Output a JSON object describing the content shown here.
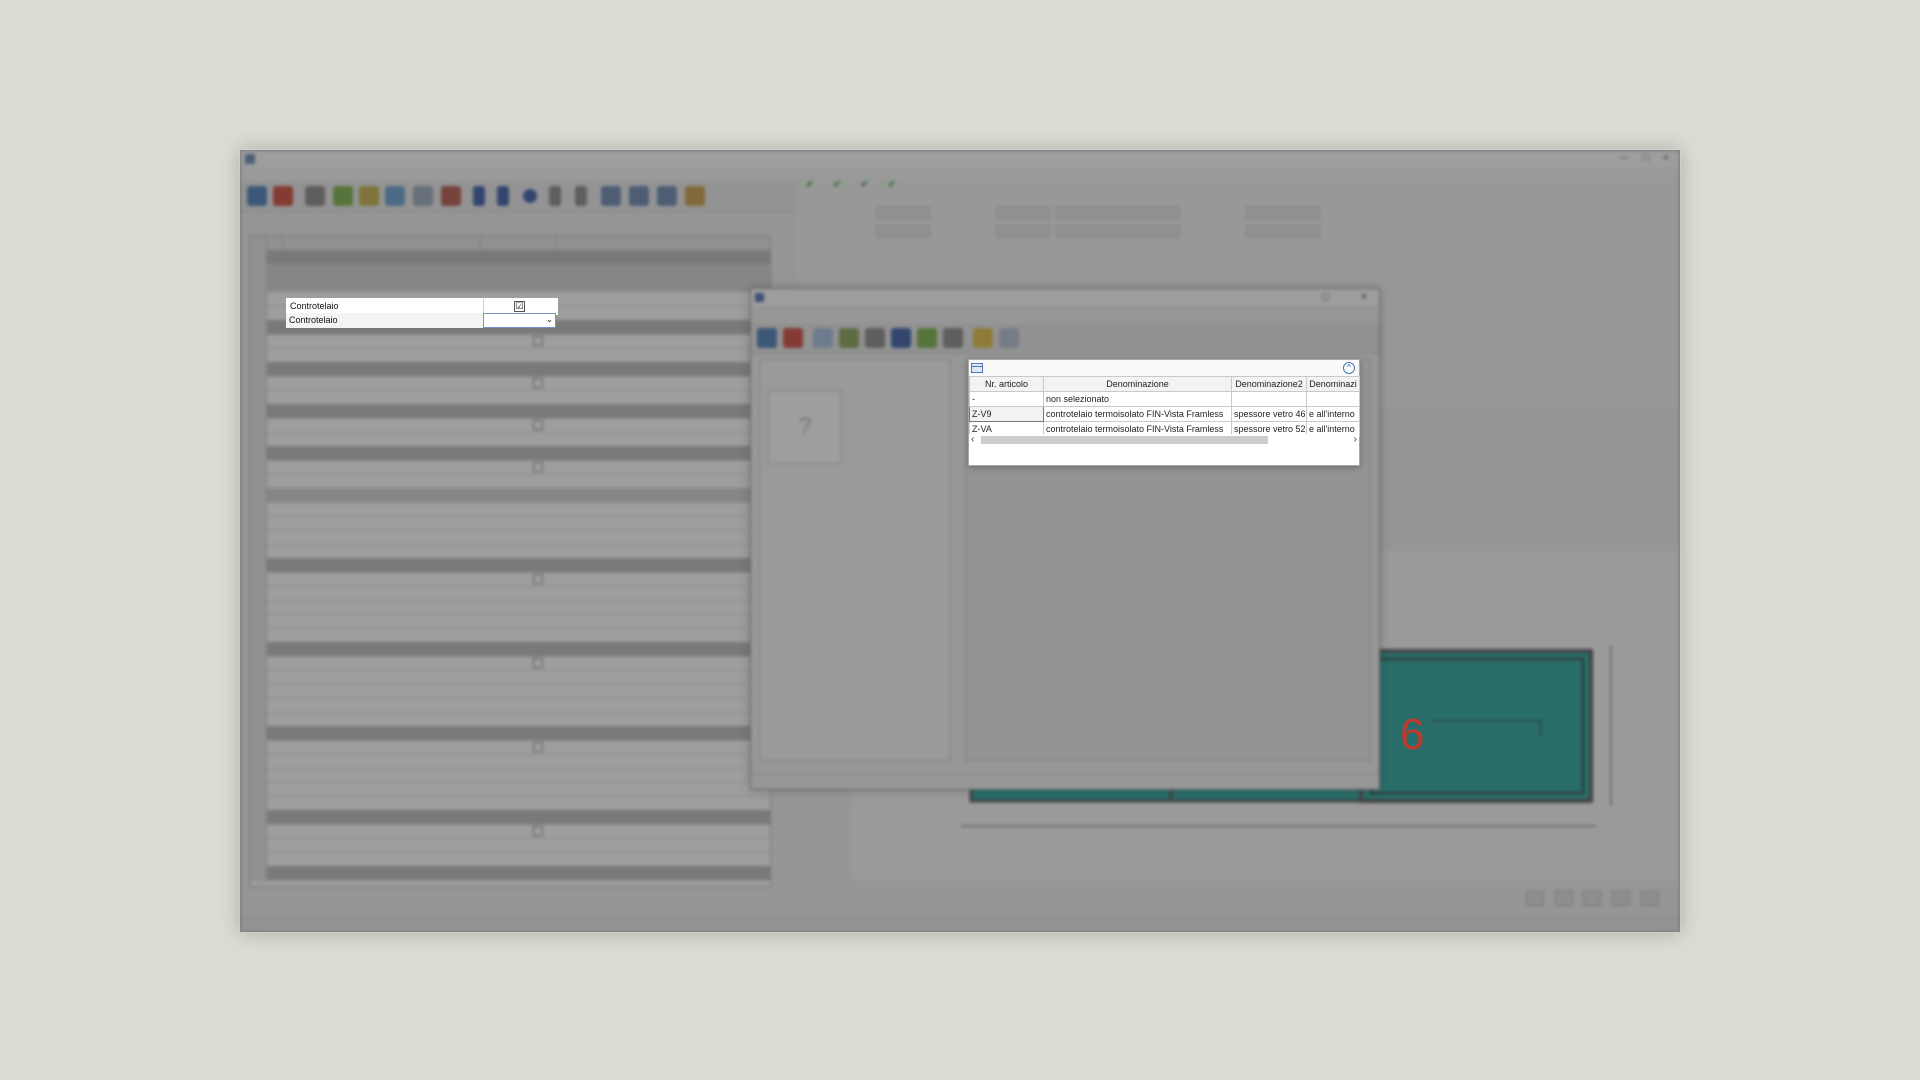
{
  "focus": {
    "row1_label": "Controtelaio",
    "row2_label": "Controtelaio",
    "checkbox_mark": "☑",
    "dropdown_arrow": "⌄"
  },
  "lookup_popup": {
    "columns": [
      "Nr. articolo",
      "Denominazione",
      "Denominazione2",
      "Denominazi"
    ],
    "rows": [
      [
        "-",
        "non selezionato",
        "",
        ""
      ],
      [
        "Z-V9",
        "controtelaio termoisolato FIN-Vista Framless",
        "spessore vetro 46",
        "e all'interno"
      ],
      [
        "Z-VA",
        "controtelaio termoisolato FIN-Vista Framless",
        "spessore vetro 52",
        "e all'interno"
      ]
    ],
    "collapse_icon": "^",
    "scroll_left": "‹",
    "scroll_right": "›"
  },
  "lookup_window": {
    "detail_placeholder": "?"
  },
  "drawing": {
    "number_label": "6",
    "accent_glass": "#2aa7a0",
    "frame_color": "#5b5b5b"
  },
  "colors": {
    "background": "#dcdcd4",
    "dim_overlay": "#282828",
    "focus_border": "#7a8fc8"
  }
}
